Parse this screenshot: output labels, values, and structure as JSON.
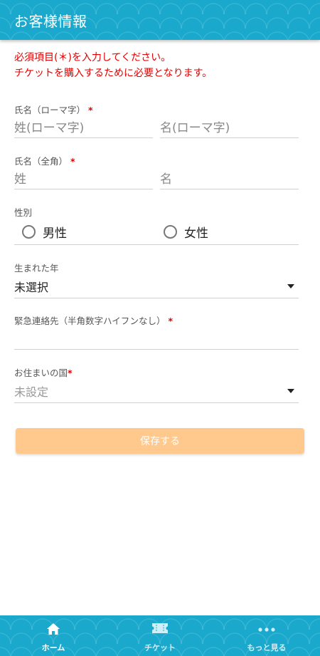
{
  "header": {
    "title": "お客様情報"
  },
  "notice": {
    "line1": "必須項目(＊)を入力してください。",
    "line2": "チケットを購入するために必要となります。"
  },
  "romaji_name": {
    "label": "氏名（ローマ字）",
    "required_mark": "*",
    "last_placeholder": "姓(ローマ字)",
    "first_placeholder": "名(ローマ字)"
  },
  "fullwidth_name": {
    "label": "氏名（全角）",
    "required_mark": "*",
    "last_placeholder": "姓",
    "first_placeholder": "名"
  },
  "gender": {
    "label": "性別",
    "options": [
      "男性",
      "女性"
    ]
  },
  "birth_year": {
    "label": "生まれた年",
    "value": "未選択"
  },
  "emergency_contact": {
    "label": "緊急連絡先（半角数字ハイフンなし）",
    "required_mark": "*",
    "value": ""
  },
  "country": {
    "label": "お住まいの国",
    "required_mark": "*",
    "value": "未設定"
  },
  "save_button": {
    "label": "保存する"
  },
  "tabbar": {
    "items": [
      {
        "label": "ホーム",
        "icon": "home-icon",
        "active": true
      },
      {
        "label": "チケット",
        "icon": "ticket-icon",
        "active": false
      },
      {
        "label": "もっと見る",
        "icon": "more-icon",
        "active": false
      }
    ]
  },
  "colors": {
    "brand": "#1aa9cc",
    "required": "#e00000",
    "button": "#ffc98e"
  }
}
